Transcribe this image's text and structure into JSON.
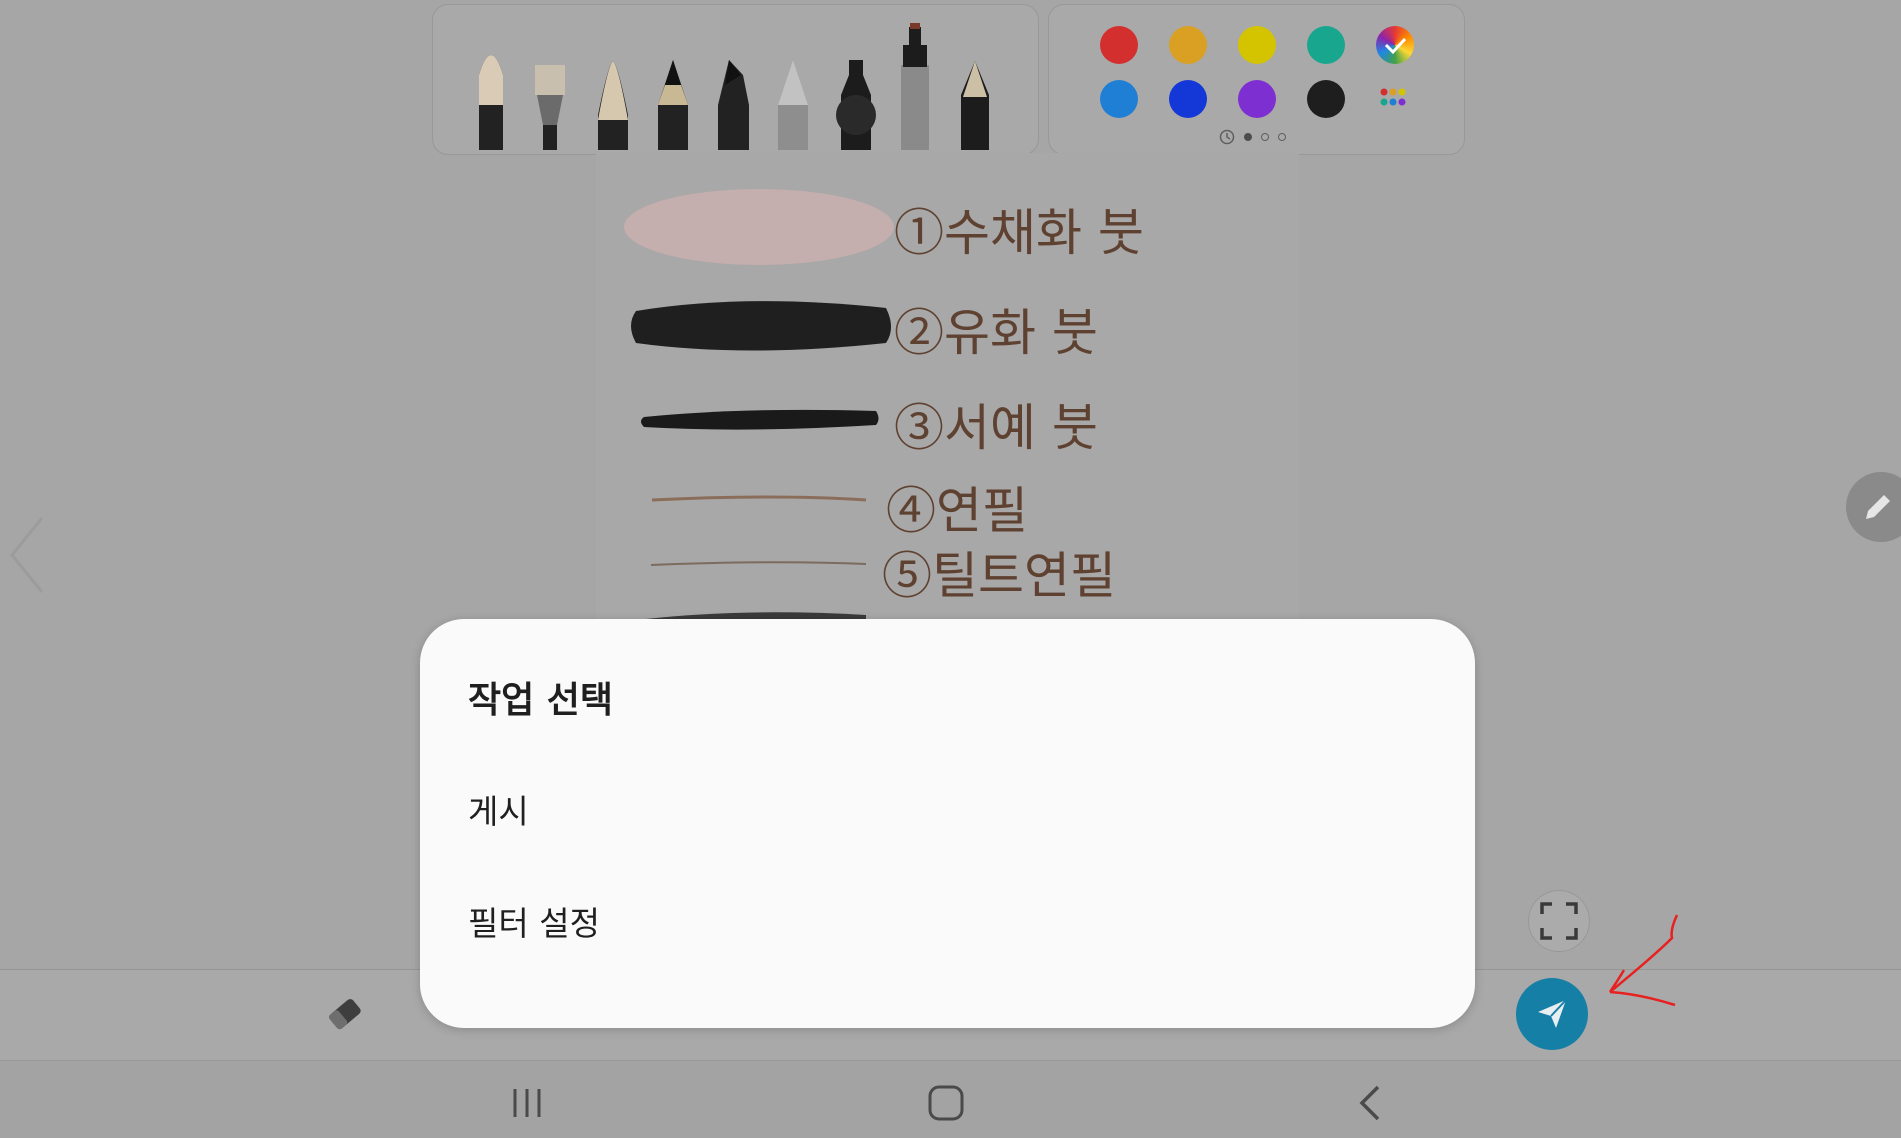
{
  "dialog": {
    "title": "작업 선택",
    "options": [
      {
        "label": "게시"
      },
      {
        "label": "필터 설정"
      }
    ]
  },
  "canvas": {
    "brush_labels": [
      "①수채화 붓",
      "②유화 붓",
      "③서예 붓",
      "④연필",
      "⑤틸트연필"
    ]
  },
  "pen_palette": {
    "tools": [
      "watercolor-brush",
      "oil-brush",
      "calligraphy-brush",
      "pencil",
      "tilt-pencil",
      "gray-pencil",
      "marker",
      "highlighter",
      "fountain-pen"
    ]
  },
  "color_palette": {
    "colors": [
      "#d32f2f",
      "#d9a024",
      "#d4c400",
      "#18a68e",
      "#1f7fd4",
      "#1438d8",
      "#7e2fd1",
      "#1e1e1e"
    ],
    "page": 1,
    "page_count": 3
  },
  "toolbar": {
    "icons": [
      "eraser-icon",
      "send-icon"
    ]
  },
  "accent": {
    "send_button": "#167fa5",
    "annotation_arrow": "#e8201f"
  }
}
